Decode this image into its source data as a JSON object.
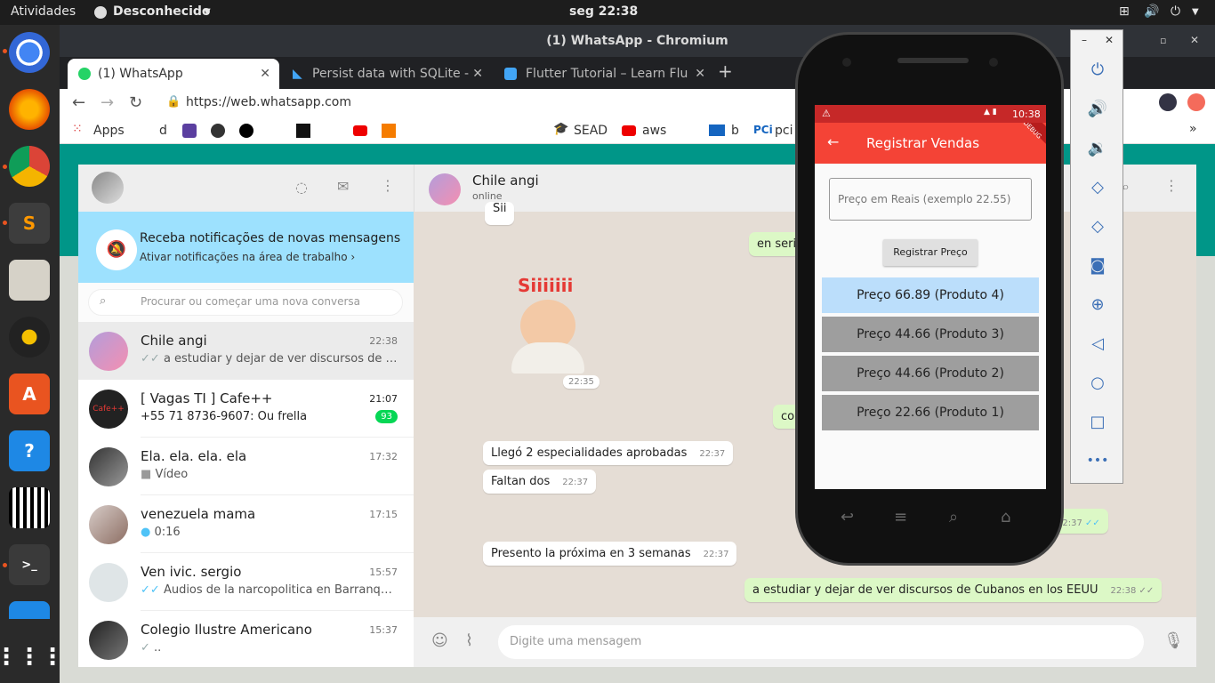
{
  "topbar": {
    "activities": "Atividades",
    "status": "Desconhecido",
    "clock": "seg 22:38"
  },
  "window": {
    "title": "(1) WhatsApp - Chromium"
  },
  "tabs": [
    {
      "label": "(1) WhatsApp"
    },
    {
      "label": "Persist data with SQLite -"
    },
    {
      "label": "Flutter Tutorial – Learn Flu"
    }
  ],
  "omnibar": {
    "url": "https://web.whatsapp.com"
  },
  "bookmarks": [
    {
      "label": "Apps"
    },
    {
      "label": "d"
    },
    {
      "label": "SEAD"
    },
    {
      "label": "aws"
    },
    {
      "label": "b"
    },
    {
      "label": "pci"
    }
  ],
  "whatsapp": {
    "notification": {
      "title": "Receba notificações de novas mensagens",
      "subtitle": "Ativar notificações na área de trabalho ›"
    },
    "search_placeholder": "Procurar ou começar uma nova conversa",
    "chats": [
      {
        "name": "Chile angi",
        "time": "22:38",
        "last": "a estudiar y dejar de ver discursos de Cubanos en los EEUU",
        "status": "✓✓"
      },
      {
        "name": "[ Vagas TI ] Cafe++",
        "time": "21:07",
        "last": "+55 71 8736-9607: Ou frella",
        "badge": "93"
      },
      {
        "name": "Ela. ela. ela. ela",
        "time": "17:32",
        "last": "Vídeo"
      },
      {
        "name": "venezuela mama",
        "time": "17:15",
        "last": "0:16"
      },
      {
        "name": "Ven ivic. sergio",
        "time": "15:57",
        "last": "Áudios de la narcopolitica en Barranquilla",
        "status": "✓✓"
      },
      {
        "name": "Colegio Ilustre Americano",
        "time": "15:37",
        "last": "..",
        "status": "✓"
      }
    ],
    "conversation": {
      "contact": "Chile angi",
      "presence": "online",
      "sticker_text": "Siiiiiii",
      "sticker_time": "22:35",
      "messages": [
        {
          "text": "Llegó 2 especialidades aprobadas",
          "time": "22:37",
          "dir": "in"
        },
        {
          "text": "Faltan dos",
          "time": "22:37",
          "dir": "in"
        },
        {
          "text": "Presento la próxima en 3 semanas",
          "time": "22:37",
          "dir": "in"
        },
        {
          "text": "a estudiar y dejar de ver discursos de Cubanos en los EEUU",
          "time": "22:38",
          "dir": "out"
        }
      ],
      "partial_out_1": "en seri",
      "partial_out_2": "com",
      "partial_out_3_time": "22:37",
      "partial_in_top": "Sii",
      "composer_placeholder": "Digite uma mensagem"
    }
  },
  "app": {
    "status_time": "10:38",
    "debug_label": "DEBUG",
    "title": "Registrar Vendas",
    "input_placeholder": "Preço em Reais (exemplo 22.55)",
    "button_label": "Registrar Preço",
    "items": [
      {
        "label": "Preço 66.89 (Produto 4)",
        "selected": true
      },
      {
        "label": "Preço 44.66 (Produto 3)",
        "selected": false
      },
      {
        "label": "Preço 44.66 (Produto 2)",
        "selected": false
      },
      {
        "label": "Preço 22.66 (Produto 1)",
        "selected": false
      }
    ],
    "colors": {
      "appbar": "#f44336",
      "selected": "#bbdefb",
      "unselected": "#9e9e9e"
    }
  },
  "emulator": {
    "more_label": "•••"
  }
}
